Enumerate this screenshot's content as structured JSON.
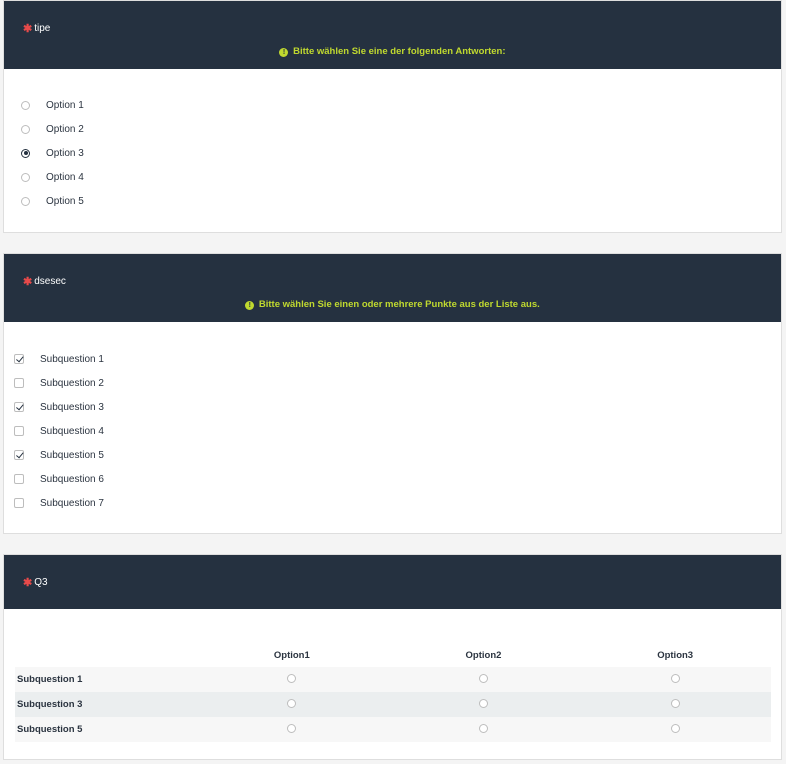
{
  "q1": {
    "title": "tipe",
    "help": "Bitte wählen Sie eine der folgenden Antworten:",
    "options": [
      {
        "label": "Option 1",
        "selected": false
      },
      {
        "label": "Option 2",
        "selected": false
      },
      {
        "label": "Option 3",
        "selected": true
      },
      {
        "label": "Option 4",
        "selected": false
      },
      {
        "label": "Option 5",
        "selected": false
      }
    ]
  },
  "q2": {
    "title": "dsesec",
    "help": "Bitte wählen Sie einen oder mehrere Punkte aus der Liste aus.",
    "options": [
      {
        "label": "Subquestion 1",
        "checked": true
      },
      {
        "label": "Subquestion 2",
        "checked": false
      },
      {
        "label": "Subquestion 3",
        "checked": true
      },
      {
        "label": "Subquestion 4",
        "checked": false
      },
      {
        "label": "Subquestion 5",
        "checked": true
      },
      {
        "label": "Subquestion 6",
        "checked": false
      },
      {
        "label": "Subquestion 7",
        "checked": false
      }
    ]
  },
  "q3": {
    "title": "Q3",
    "columns": [
      "Option1",
      "Option2",
      "Option3"
    ],
    "rows": [
      "Subquestion 1",
      "Subquestion 3",
      "Subquestion 5"
    ]
  },
  "icons": {
    "mandatory": "asterisk-icon",
    "info": "info-circle-icon"
  },
  "colors": {
    "header_bg": "#253140",
    "help_text": "#c0d92f",
    "mandatory_star": "#e84a4a"
  }
}
